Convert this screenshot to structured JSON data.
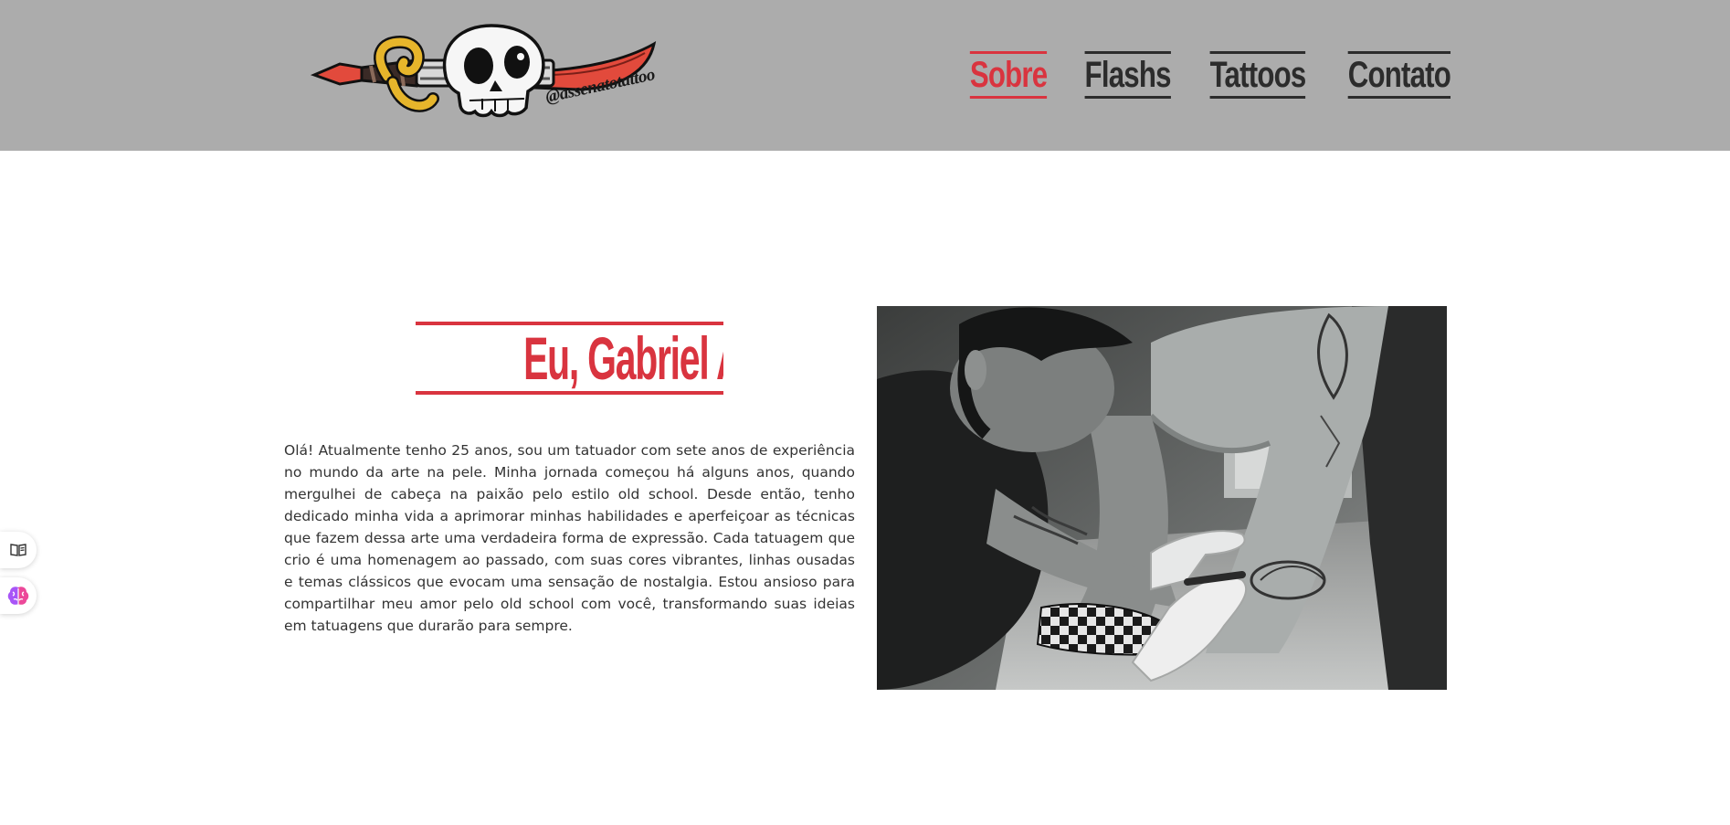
{
  "header": {
    "logo_handle": "@assenatotattoo",
    "background_color": "#acacac",
    "logo_icon": "dagger-skull-logo-icon"
  },
  "nav": {
    "items": [
      {
        "label": "Sobre",
        "active": true
      },
      {
        "label": "Flashs",
        "active": false
      },
      {
        "label": "Tattoos",
        "active": false
      },
      {
        "label": "Contato",
        "active": false
      }
    ],
    "active_color": "#d9343f",
    "text_color": "#2c2c2c"
  },
  "about": {
    "title": "Eu, Gabriel Assenato",
    "paragraph": "Olá! Atualmente tenho 25 anos, sou um tatuador com sete anos de experiência no mundo da arte na pele. Minha jornada começou há alguns anos, quando mergulhei de cabeça na paixão pelo estilo old school. Desde então, tenho dedicado minha vida a aprimorar minhas habilidades e aperfeiçoar as técnicas que fazem dessa arte uma verdadeira forma de expressão. Cada tatuagem que crio é uma homenagem ao passado, com suas cores vibrantes, linhas ousadas e temas clássicos que evocam uma sensação de nostalgia. Estou ansioso para compartilhar meu amor pelo old school com você, transformando suas ideias em tatuagens que durarão para sempre.",
    "photo_icon": "tattoo-artist-photo"
  },
  "side_widgets": {
    "reader_icon": "book-reader-icon",
    "brain_icon": "brain-icon"
  }
}
